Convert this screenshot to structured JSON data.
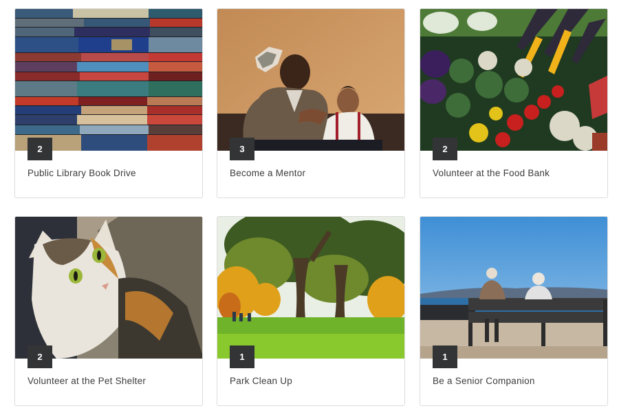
{
  "cards": [
    {
      "title": "Public Library Book Drive",
      "count": "2",
      "image_icon": "books-photo"
    },
    {
      "title": "Become a Mentor",
      "count": "3",
      "image_icon": "mentor-photo"
    },
    {
      "title": "Volunteer at the Food Bank",
      "count": "2",
      "image_icon": "vegetables-photo"
    },
    {
      "title": "Volunteer at the Pet Shelter",
      "count": "2",
      "image_icon": "cat-photo"
    },
    {
      "title": "Park Clean Up",
      "count": "1",
      "image_icon": "park-photo"
    },
    {
      "title": "Be a Senior Companion",
      "count": "1",
      "image_icon": "seniors-bench-photo"
    }
  ],
  "colors": {
    "badge_bg": "#333436",
    "badge_text": "#ffffff",
    "title_text": "#3b3b3b",
    "card_border": "#dcdcdc"
  }
}
